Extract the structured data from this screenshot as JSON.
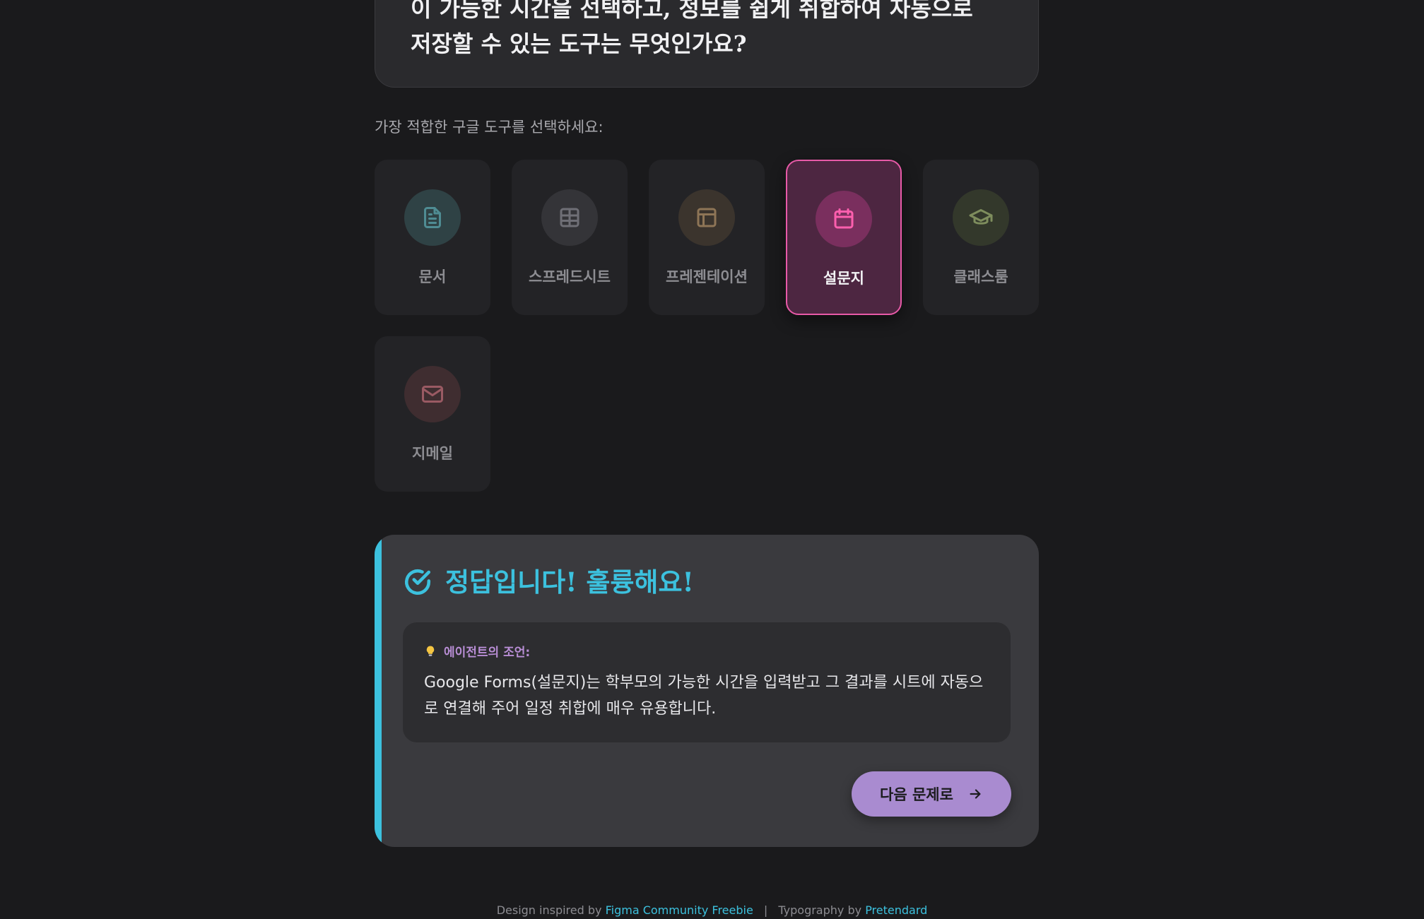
{
  "question": {
    "text": "이 가능한 시간을 선택하고, 정보를 쉽게 취합하여 자동으로\n저장할 수 있는 도구는 무엇인가요?"
  },
  "prompt_label": "가장 적합한 구글 도구를 선택하세요:",
  "options": [
    {
      "label": "문서",
      "icon": "document-icon",
      "color": "#4f8c93",
      "circle": "#2f4245"
    },
    {
      "label": "스프레드시트",
      "icon": "table-icon",
      "color": "#6f6f76",
      "circle": "#343438"
    },
    {
      "label": "프레젠테이션",
      "icon": "layout-icon",
      "color": "#8e7556",
      "circle": "#3b342d"
    },
    {
      "label": "설문지",
      "icon": "calendar-icon",
      "color": "#ff5fae",
      "circle": "#7a2f5e",
      "selected": true
    },
    {
      "label": "클래스룸",
      "icon": "graduation-cap-icon",
      "color": "#7e8d5d",
      "circle": "#33382b"
    },
    {
      "label": "지메일",
      "icon": "mail-icon",
      "color": "#9a5a63",
      "circle": "#3f2d30"
    }
  ],
  "feedback": {
    "title": "정답입니다! 훌륭해요!",
    "accent_color": "#3cc1de",
    "advice_heading": "에이전트의 조언:",
    "advice_text": "Google Forms(설문지)는 학부모의 가능한 시간을 입력받고 그 결과를 시트에 자동으로 연결해 주어 일정 취합에 매우 유용합니다.",
    "next_label": "다음 문제로"
  },
  "footer": {
    "design_prefix": "Design inspired by",
    "design_link": "Figma Community Freebie",
    "separator": "|",
    "type_prefix": "Typography by",
    "type_link": "Pretendard"
  }
}
